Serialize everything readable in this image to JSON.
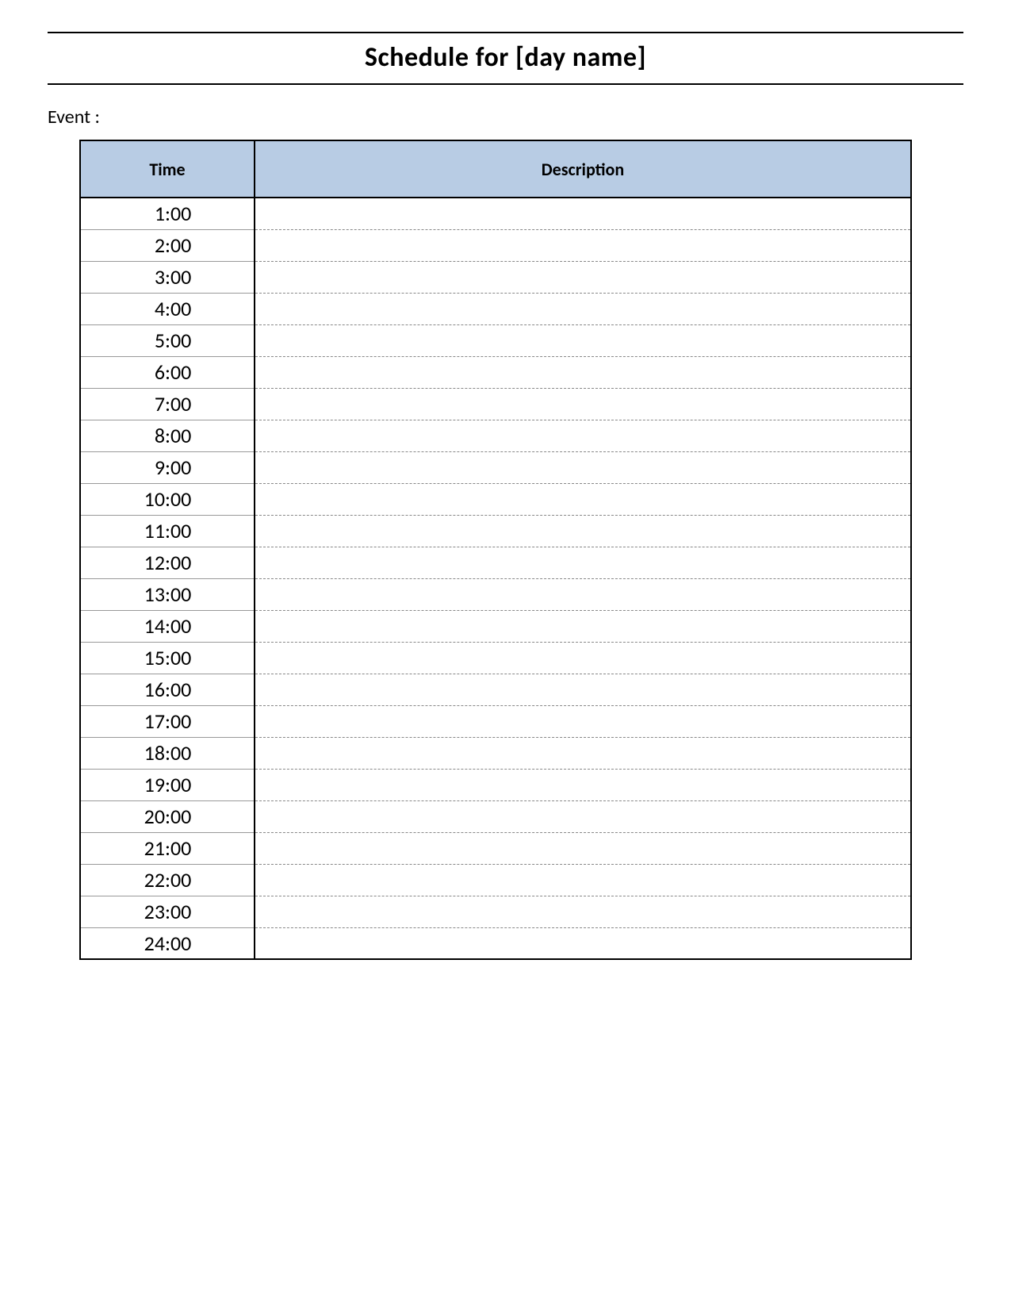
{
  "title": "Schedule for [day name]",
  "event_label": "Event :",
  "columns": {
    "time": "Time",
    "description": "Description"
  },
  "rows": [
    {
      "time": "1 :00",
      "description": ""
    },
    {
      "time": "2 :00",
      "description": ""
    },
    {
      "time": "3 :00",
      "description": ""
    },
    {
      "time": "4 :00",
      "description": ""
    },
    {
      "time": "5 :00",
      "description": ""
    },
    {
      "time": "6 :00",
      "description": ""
    },
    {
      "time": "7 :00",
      "description": ""
    },
    {
      "time": "8 :00",
      "description": ""
    },
    {
      "time": "9 :00",
      "description": ""
    },
    {
      "time": "10 :00",
      "description": ""
    },
    {
      "time": "11 :00",
      "description": ""
    },
    {
      "time": "12 :00",
      "description": ""
    },
    {
      "time": "13 :00",
      "description": ""
    },
    {
      "time": "14 :00",
      "description": ""
    },
    {
      "time": "15 :00",
      "description": ""
    },
    {
      "time": "16 :00",
      "description": ""
    },
    {
      "time": "17 :00",
      "description": ""
    },
    {
      "time": "18 :00",
      "description": ""
    },
    {
      "time": "19 :00",
      "description": ""
    },
    {
      "time": "20 :00",
      "description": ""
    },
    {
      "time": "21 :00",
      "description": ""
    },
    {
      "time": "22 :00",
      "description": ""
    },
    {
      "time": "23 :00",
      "description": ""
    },
    {
      "time": "24 :00",
      "description": ""
    }
  ]
}
